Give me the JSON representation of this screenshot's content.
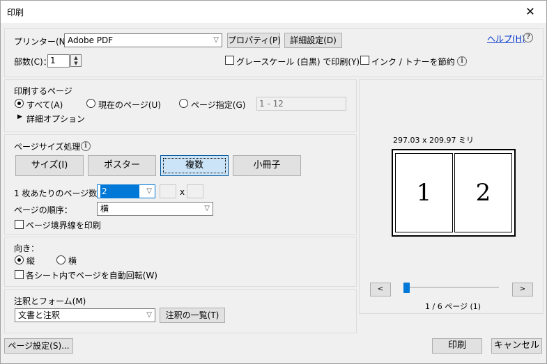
{
  "window": {
    "title": "印刷",
    "close_glyph": "✕"
  },
  "printer": {
    "label": "プリンター(N)：",
    "selected": "Adobe PDF",
    "properties_button": "プロパティ(P)",
    "advanced_button": "詳細設定(D)",
    "help_link": "ヘルプ(H)",
    "copies_label": "部数(C)：",
    "copies_value": "1",
    "grayscale_label": "グレースケール (白黒) で印刷(Y)",
    "save_ink_label": "インク / トナーを節約"
  },
  "pages_to_print": {
    "heading": "印刷するページ",
    "all": "すべて(A)",
    "current": "現在のページ(U)",
    "range": "ページ指定(G)",
    "range_value": "1 - 12",
    "more_options": "詳細オプション"
  },
  "page_sizing": {
    "heading": "ページサイズ処理",
    "buttons": [
      "サイズ(I)",
      "ポスター",
      "複数",
      "小冊子"
    ],
    "pages_per_sheet_label": "1 枚あたりのページ数：",
    "pages_per_sheet_value": "2",
    "x_label": "x",
    "page_order_label": "ページの順序：",
    "page_order_value": "横",
    "print_border_label": "ページ境界線を印刷"
  },
  "orientation": {
    "heading": "向き：",
    "portrait": "縦",
    "landscape": "横",
    "auto_rotate_label": "各シート内でページを自動回転(W)"
  },
  "comments_forms": {
    "heading": "注釈とフォーム(M)",
    "selected": "文書と注釈",
    "summary_button": "注釈の一覧(T)"
  },
  "preview": {
    "dimensions": "297.03 x 209.97 ミリ",
    "pages": [
      "1",
      "2"
    ],
    "prev": "<",
    "next": ">",
    "page_status": "1 / 6 ページ (1)",
    "slider_fraction": 0.0
  },
  "footer": {
    "page_setup_button": "ページ設定(S)...",
    "print_button": "印刷",
    "cancel_button": "キャンセル"
  }
}
